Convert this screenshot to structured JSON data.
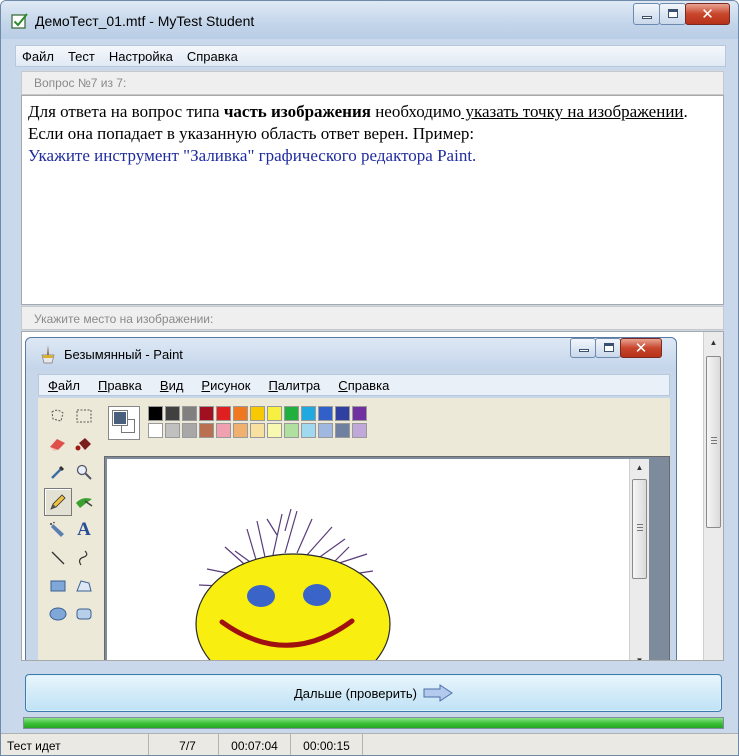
{
  "window": {
    "title": "ДемоТест_01.mtf - MyTest Student"
  },
  "menu": [
    "Файл",
    "Тест",
    "Настройка",
    "Справка"
  ],
  "question": {
    "header": "Вопрос №7 из 7:",
    "text_parts": {
      "p1": "Для ответа на вопрос типа ",
      "p2": "часть изображения",
      "p3": " необходимо",
      "p4": " указать точку на изображении",
      "p5": ". Если она попадает в указанную область ответ верен. Пример:",
      "p6": "Укажите инструмент \"Заливка\" графического редактора Paint."
    }
  },
  "image_section": {
    "header": "Укажите место на изображении:"
  },
  "paint": {
    "title": "Безымянный - Paint",
    "menu": [
      {
        "acc": "Ф",
        "rest": "айл"
      },
      {
        "acc": "П",
        "rest": "равка"
      },
      {
        "acc": "В",
        "rest": "ид"
      },
      {
        "acc": "Р",
        "rest": "исунок"
      },
      {
        "acc": "П",
        "rest": "алитра"
      },
      {
        "acc": "С",
        "rest": "правка"
      }
    ],
    "palette_row1": [
      "#000000",
      "#404040",
      "#808080",
      "#a01020",
      "#e02020",
      "#f07820",
      "#f8c800",
      "#f8f040",
      "#20b040",
      "#20a8e0",
      "#3060c8",
      "#3040a0",
      "#7030a0"
    ],
    "palette_row2": [
      "#ffffff",
      "#c0c0c0",
      "#a8a8a8",
      "#b87050",
      "#f0a0b0",
      "#f0b070",
      "#f8e0a0",
      "#f8f8b0",
      "#b0e0a0",
      "#a0d8f0",
      "#a0b8e0",
      "#7080a0",
      "#c0a8d8"
    ]
  },
  "next_button": {
    "label": "Дальше (проверить)"
  },
  "progress": {
    "fraction": 1.0,
    "color": "#3ec33a"
  },
  "status": {
    "state": "Тест идет",
    "position": "7/7",
    "elapsed": "00:07:04",
    "remaining": "00:00:15"
  }
}
